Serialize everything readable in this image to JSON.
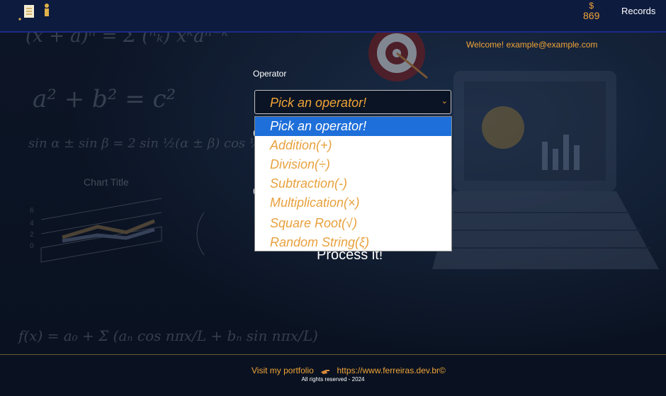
{
  "header": {
    "coins_symbol": "$",
    "coins_value": "869",
    "records_label": "Records"
  },
  "welcome_text": "Welcome! example@example.com",
  "form": {
    "operator_label": "Operator",
    "select_value": "Pick an operator!",
    "options": [
      "Pick an operator!",
      "Addition(+)",
      "Division(÷)",
      "Subtraction(-)",
      "Multiplication(×)",
      "Square Root(√)",
      "Random String(ξ)"
    ],
    "process_label": "Process it!"
  },
  "footer": {
    "portfolio_label": "Visit my portfolio",
    "portfolio_url": "https://www.ferreiras.dev.br©",
    "rights": "All rights reserved -  2024"
  },
  "colors": {
    "accent": "#f0a437",
    "header_bg": "#0d1b3e",
    "selected_option": "#1e6fd9",
    "page_bg": "#0b1424"
  },
  "icons": [
    "app-logo-icon",
    "chevron-down-icon",
    "pointing-hand-icon"
  ]
}
